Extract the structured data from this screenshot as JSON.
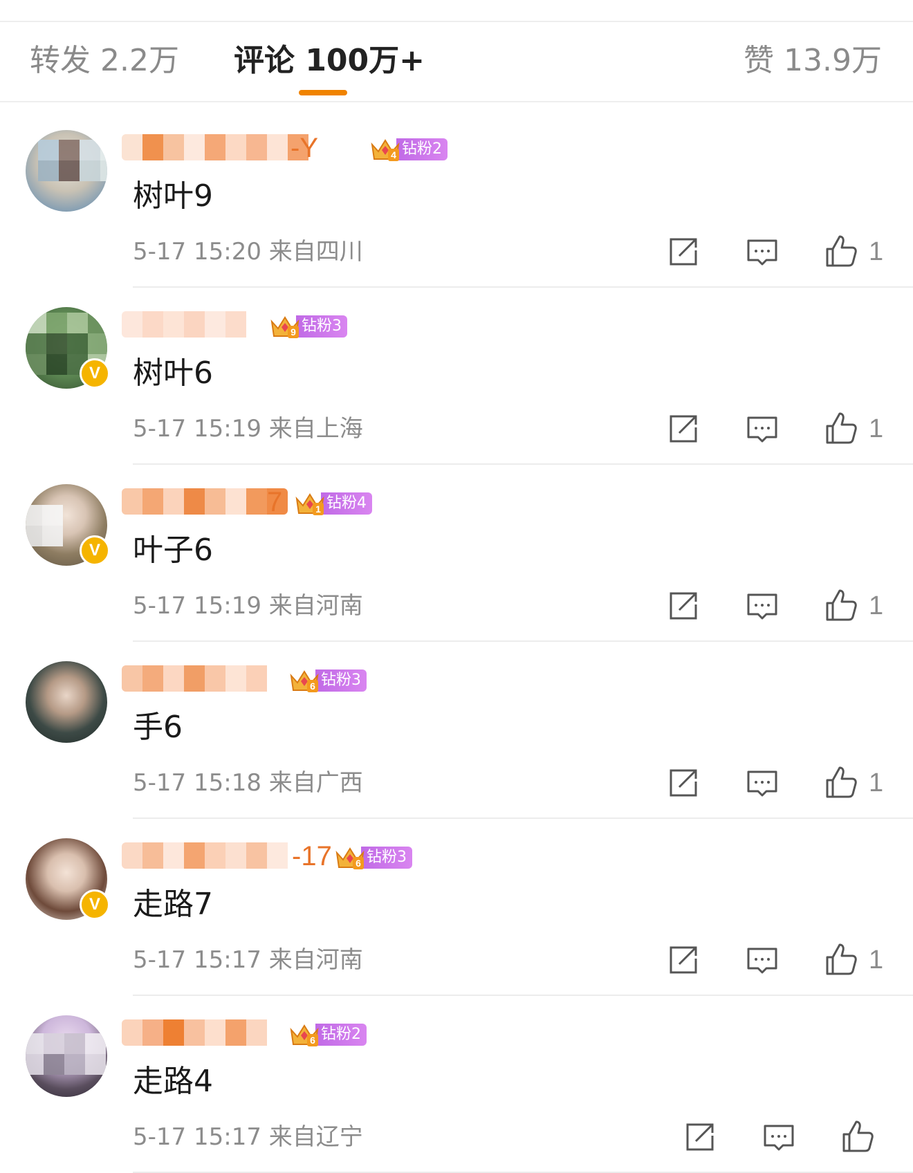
{
  "colors": {
    "accent_orange": "#f08300",
    "username_orange": "#e8742a",
    "fan_purple": "#c06ae6",
    "verified_gold": "#f5b400",
    "muted_text": "#8c8c8c"
  },
  "tabs": {
    "reposts": "转发 2.2万",
    "comments": "评论 100万+",
    "likes": "赞 13.9万",
    "active": "comments"
  },
  "comments": [
    {
      "name_visible_tail": "-Y",
      "fan_badge": "钻粉2",
      "crown_level": "4",
      "verified": false,
      "text": "树叶9",
      "meta": "5-17 15:20 来自四川",
      "likes": "1"
    },
    {
      "name_visible_tail": "",
      "fan_badge": "钻粉3",
      "crown_level": "9",
      "verified": true,
      "text": "树叶6",
      "meta": "5-17 15:19 来自上海",
      "likes": "1"
    },
    {
      "name_visible_tail": "7",
      "fan_badge": "钻粉4",
      "crown_level": "1",
      "verified": true,
      "text": "叶子6",
      "meta": "5-17 15:19 来自河南",
      "likes": "1"
    },
    {
      "name_visible_tail": "",
      "fan_badge": "钻粉3",
      "crown_level": "6",
      "verified": false,
      "text": "手6",
      "meta": "5-17 15:18 来自广西",
      "likes": "1"
    },
    {
      "name_visible_tail": "-17",
      "fan_badge": "钻粉3",
      "crown_level": "6",
      "verified": true,
      "text": "走路7",
      "meta": "5-17 15:17 来自河南",
      "likes": "1"
    },
    {
      "name_visible_tail": "",
      "fan_badge": "钻粉2",
      "crown_level": "6",
      "verified": false,
      "text": "走路4",
      "meta": "5-17 15:17 来自辽宁",
      "likes": ""
    }
  ],
  "icons": {
    "share": "share-icon",
    "reply": "reply-icon",
    "like": "thumbs-up-icon",
    "crown": "crown-icon",
    "verified": "verified-v-icon"
  }
}
